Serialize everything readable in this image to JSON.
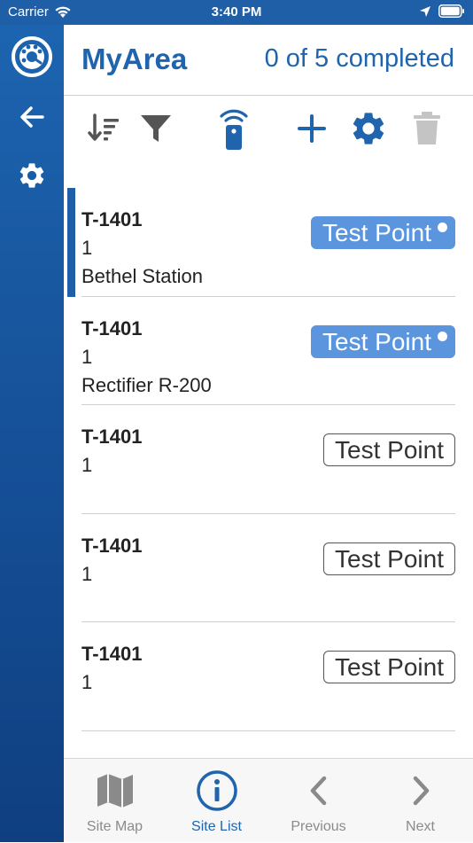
{
  "status_bar": {
    "carrier": "Carrier",
    "time": "3:40 PM"
  },
  "left_rail": {
    "items": [
      {
        "icon": "app-logo-icon"
      },
      {
        "icon": "back-arrow-icon"
      },
      {
        "icon": "gear-icon"
      }
    ]
  },
  "header": {
    "title": "MyArea",
    "progress": "0 of 5 completed"
  },
  "toolbar": {
    "items": [
      {
        "icon": "sort-icon"
      },
      {
        "icon": "filter-icon"
      },
      {
        "icon": "remote-icon"
      },
      {
        "icon": "add-icon"
      },
      {
        "icon": "settings-icon"
      },
      {
        "icon": "trash-icon",
        "disabled": true
      }
    ]
  },
  "list": {
    "items": [
      {
        "id": "T-1401",
        "number": "1",
        "location": "Bethel Station",
        "badge": "Test Point",
        "badge_style": "filled",
        "selected": true
      },
      {
        "id": "T-1401",
        "number": "1",
        "location": "Rectifier R-200",
        "badge": "Test Point",
        "badge_style": "filled",
        "selected": false
      },
      {
        "id": "T-1401",
        "number": "1",
        "location": "",
        "badge": "Test Point",
        "badge_style": "outline",
        "selected": false
      },
      {
        "id": "T-1401",
        "number": "1",
        "location": "",
        "badge": "Test Point",
        "badge_style": "outline",
        "selected": false
      },
      {
        "id": "T-1401",
        "number": "1",
        "location": "",
        "badge": "Test Point",
        "badge_style": "outline",
        "selected": false
      }
    ]
  },
  "tab_bar": {
    "items": [
      {
        "label": "Site Map",
        "icon": "map-icon",
        "active": false
      },
      {
        "label": "Site List",
        "icon": "info-icon",
        "active": true
      },
      {
        "label": "Previous",
        "icon": "chevron-left-icon",
        "active": false
      },
      {
        "label": "Next",
        "icon": "chevron-right-icon",
        "active": false
      }
    ]
  },
  "colors": {
    "primary": "#1f64ad",
    "rail": "#1f5fa8",
    "badge_filled": "#5b95de",
    "tab_inactive": "#8a8a8a"
  }
}
